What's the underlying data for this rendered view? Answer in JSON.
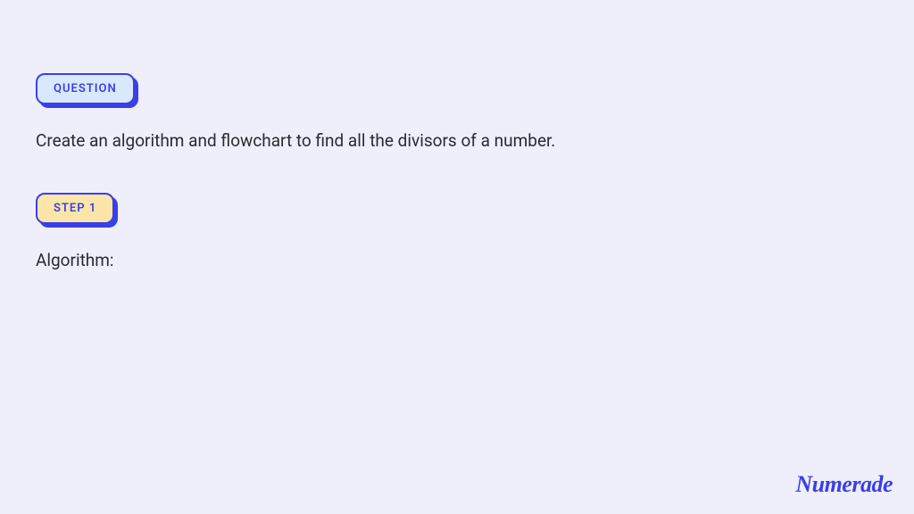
{
  "badges": {
    "question": "QUESTION",
    "step1": "STEP 1"
  },
  "question_text": "Create an algorithm and flowchart to find all the divisors of a number.",
  "step1_text": "Algorithm:",
  "brand": "Numerade"
}
